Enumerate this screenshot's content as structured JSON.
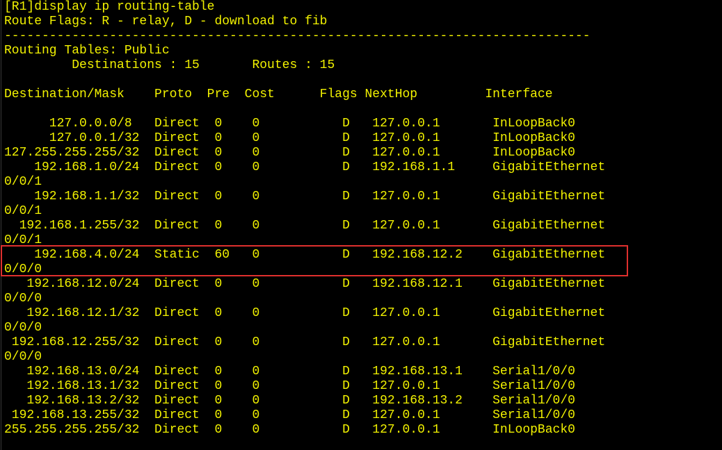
{
  "terminal": {
    "colors": {
      "background": "#000000",
      "text": "#f2f200",
      "highlight": "#e0302e"
    },
    "lines": [
      "[R1]display ip routing-table",
      "Route Flags: R - relay, D - download to fib",
      "------------------------------------------------------------------------------",
      "Routing Tables: Public",
      "         Destinations : 15       Routes : 15",
      "",
      "Destination/Mask    Proto  Pre  Cost      Flags NextHop         Interface",
      "",
      "      127.0.0.0/8   Direct  0    0           D   127.0.0.1       InLoopBack0",
      "      127.0.0.1/32  Direct  0    0           D   127.0.0.1       InLoopBack0",
      "127.255.255.255/32  Direct  0    0           D   127.0.0.1       InLoopBack0",
      "    192.168.1.0/24  Direct  0    0           D   192.168.1.1     GigabitEthernet",
      "0/0/1",
      "    192.168.1.1/32  Direct  0    0           D   127.0.0.1       GigabitEthernet",
      "0/0/1",
      "  192.168.1.255/32  Direct  0    0           D   127.0.0.1       GigabitEthernet",
      "0/0/1",
      "    192.168.4.0/24  Static  60   0           D   192.168.12.2    GigabitEthernet",
      "0/0/0",
      "   192.168.12.0/24  Direct  0    0           D   192.168.12.1    GigabitEthernet",
      "0/0/0",
      "   192.168.12.1/32  Direct  0    0           D   127.0.0.1       GigabitEthernet",
      "0/0/0",
      " 192.168.12.255/32  Direct  0    0           D   127.0.0.1       GigabitEthernet",
      "0/0/0",
      "   192.168.13.0/24  Direct  0    0           D   192.168.13.1    Serial1/0/0",
      "   192.168.13.1/32  Direct  0    0           D   127.0.0.1       Serial1/0/0",
      "   192.168.13.2/32  Direct  0    0           D   192.168.13.2    Serial1/0/0",
      " 192.168.13.255/32  Direct  0    0           D   127.0.0.1       Serial1/0/0",
      "255.255.255.255/32  Direct  0    0           D   127.0.0.1       InLoopBack0"
    ]
  }
}
